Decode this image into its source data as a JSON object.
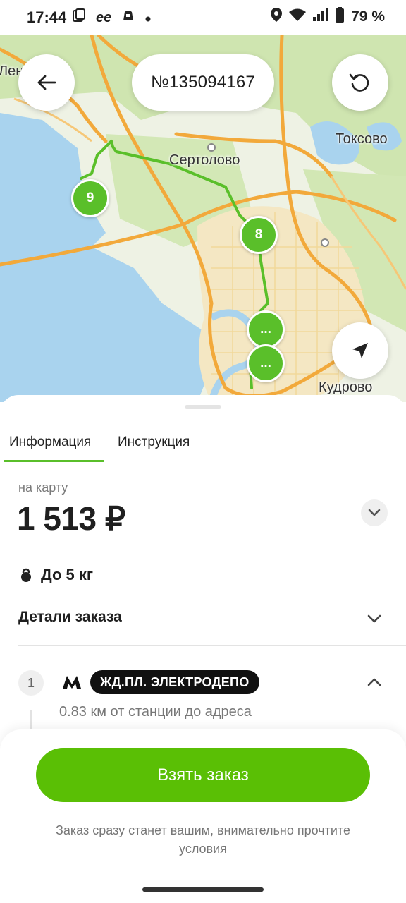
{
  "status_bar": {
    "time": "17:44",
    "battery": "79 %",
    "left_icons": [
      "screenshot-icon",
      "app-notification-icon",
      "app-notification-icon-2",
      "dot-icon"
    ],
    "right_icons": [
      "location-icon",
      "wifi-icon",
      "signal-icon",
      "battery-icon"
    ]
  },
  "map": {
    "order_number": "№135094167",
    "labels": {
      "sertolovo": "Сертолово",
      "toksovo": "Токсово",
      "kudrovo": "Кудрово",
      "left_edge": "Лен",
      "right_edge": "о"
    },
    "markers": {
      "m9": "9",
      "m8": "8",
      "m_a": "...",
      "m_b": "..."
    },
    "route_color": "#5abf2a"
  },
  "tabs": {
    "info": "Информация",
    "instruction": "Инструкция"
  },
  "info": {
    "price_caption": "на карту",
    "price": "1 513 ₽",
    "weight": "До 5 кг",
    "details_label": "Детали заказа"
  },
  "stop": {
    "number": "1",
    "station": "ЖД.ПЛ. ЭЛЕКТРОДЕПО",
    "distance": "0.83 км от станции до адреса"
  },
  "action": {
    "take_button": "Взять заказ",
    "note": "Заказ сразу станет вашим, внимательно прочтите условия",
    "accent_color": "#5abf05"
  }
}
